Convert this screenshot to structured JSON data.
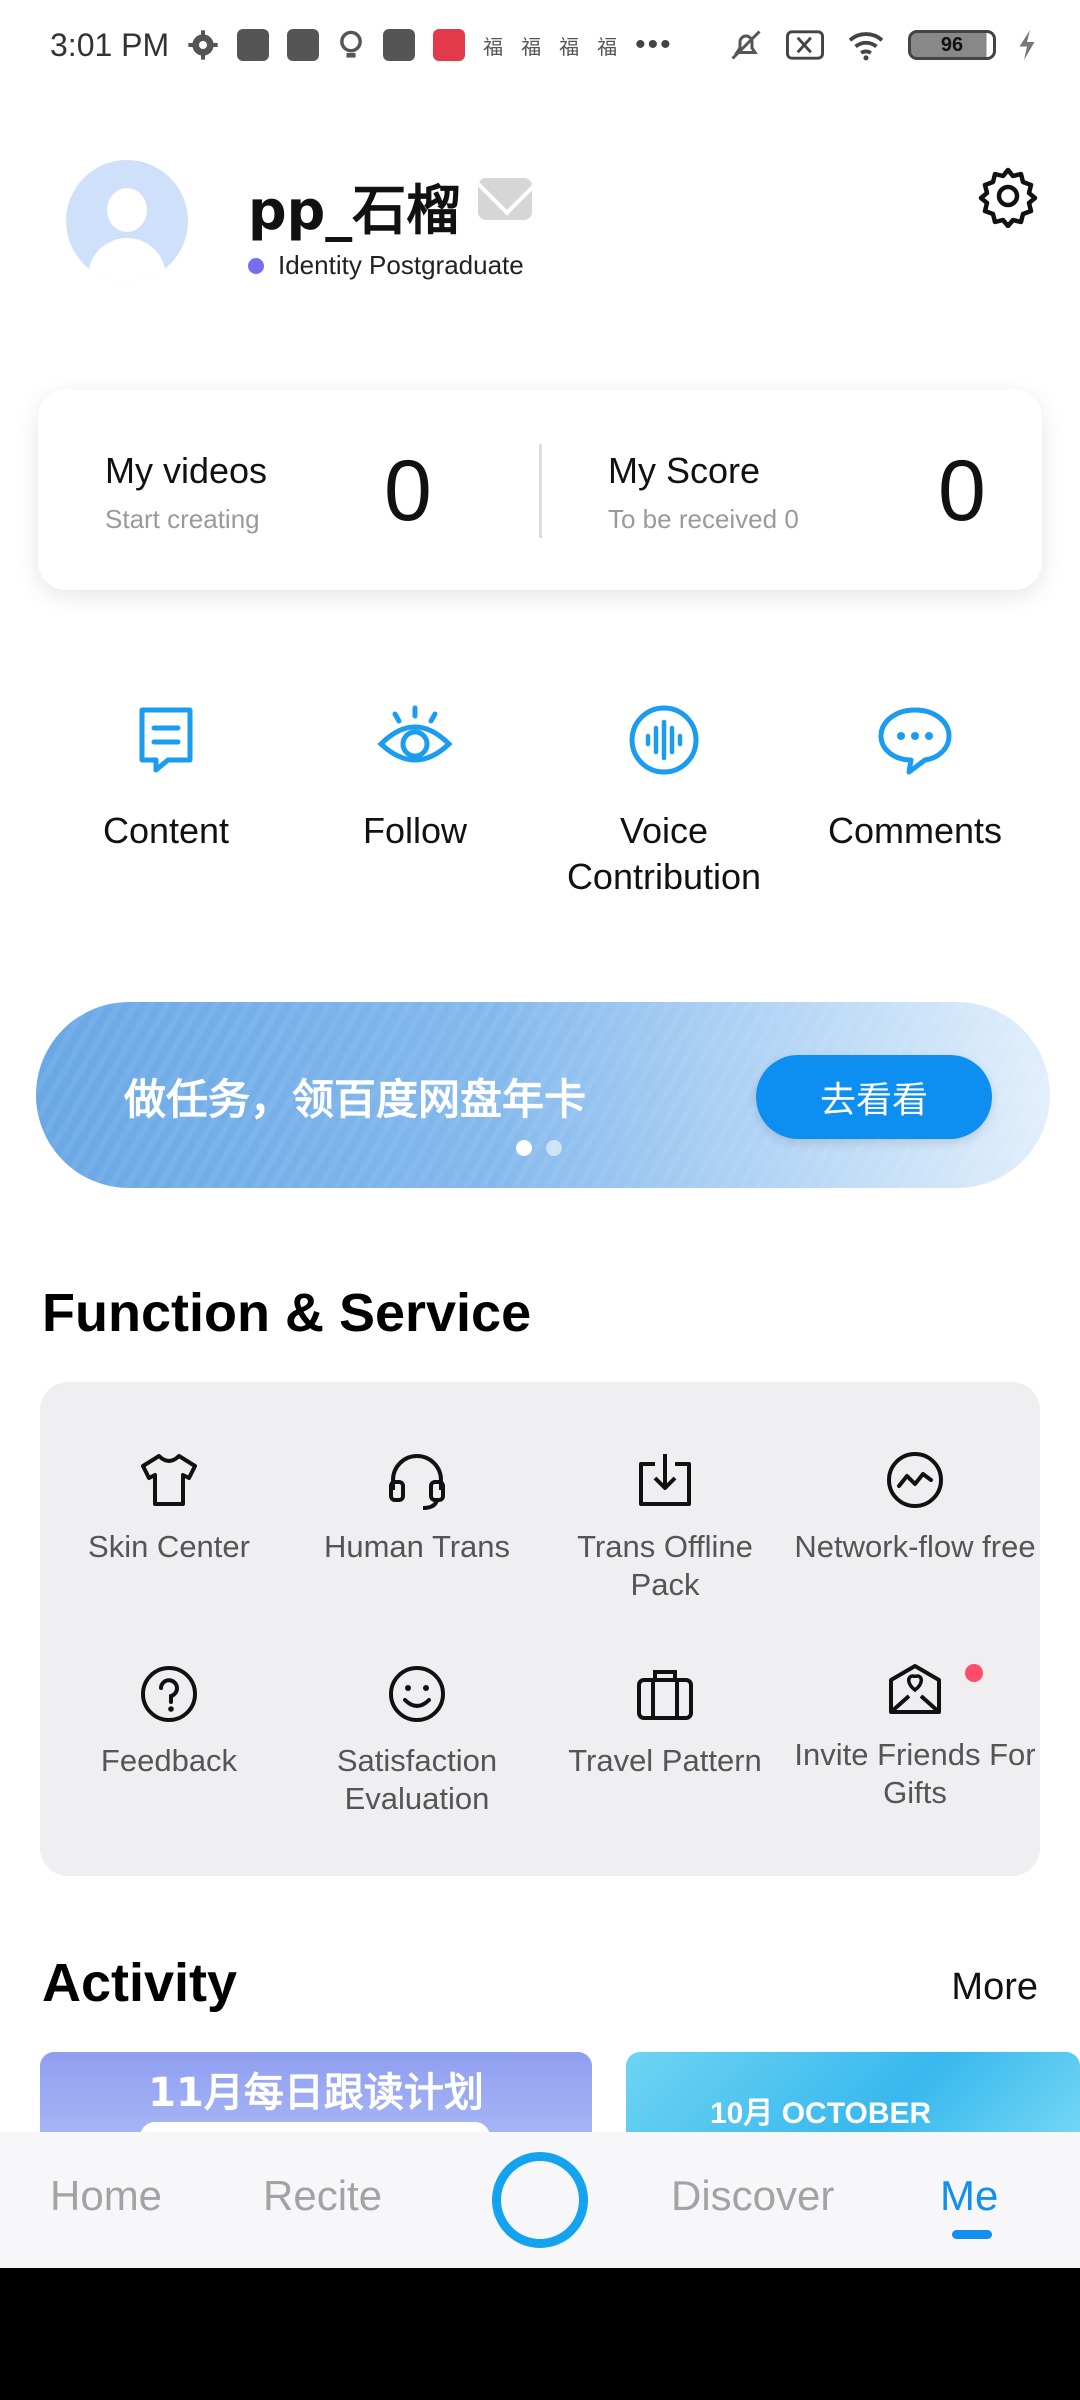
{
  "status_bar": {
    "time": "3:01 PM",
    "battery": "96",
    "icons": [
      "settings-gear-icon",
      "mi-store-icon",
      "mi-store-icon",
      "bulb-icon",
      "question-icon",
      "app-icon",
      "fu-icon",
      "fu-icon",
      "fu-icon",
      "fu-icon",
      "more-dots-icon",
      "mute-icon",
      "close-box-icon",
      "wifi-icon",
      "battery-icon",
      "charging-icon"
    ],
    "fu_glyph": "福",
    "more": "•••"
  },
  "profile": {
    "username": "pp_石榴",
    "identity": "Identity Postgraduate"
  },
  "stats": {
    "videos_title": "My videos",
    "videos_sub": "Start creating",
    "videos_count": "0",
    "score_title": "My Score",
    "score_sub": "To be received 0",
    "score_count": "0"
  },
  "quick_actions": [
    {
      "label": "Content",
      "icon": "content-doc-icon"
    },
    {
      "label": "Follow",
      "icon": "eye-icon"
    },
    {
      "label": "Voice Contribution",
      "icon": "voice-wave-icon"
    },
    {
      "label": "Comments",
      "icon": "chat-bubble-icon"
    }
  ],
  "banner": {
    "text": "做任务，领百度网盘年卡",
    "button": "去看看",
    "page": 1,
    "pages": 2
  },
  "function_service": {
    "title": "Function & Service",
    "items": [
      {
        "label": "Skin Center",
        "icon": "tshirt-icon"
      },
      {
        "label": "Human Trans",
        "icon": "headset-icon"
      },
      {
        "label": "Trans Offline Pack",
        "icon": "download-icon"
      },
      {
        "label": "Network-flow free",
        "icon": "wave-circle-icon"
      },
      {
        "label": "Feedback",
        "icon": "question-circle-icon"
      },
      {
        "label": "Satisfaction Evaluation",
        "icon": "smiley-icon"
      },
      {
        "label": "Travel Pattern",
        "icon": "suitcase-icon"
      },
      {
        "label": "Invite Friends For Gifts",
        "icon": "gift-envelope-icon"
      }
    ]
  },
  "activity": {
    "title": "Activity",
    "more": "More",
    "cards": [
      "11月每日跟读计划",
      "10月 OCTOBER"
    ]
  },
  "bottom_nav": {
    "items": [
      "Home",
      "Recite",
      "Discover",
      "Me"
    ],
    "active": "Me"
  },
  "colors": {
    "accent": "#148ff0",
    "icon_blue": "#1a9cf0",
    "panel_bg": "#efeff1",
    "banner_button": "#0d8ef1"
  }
}
